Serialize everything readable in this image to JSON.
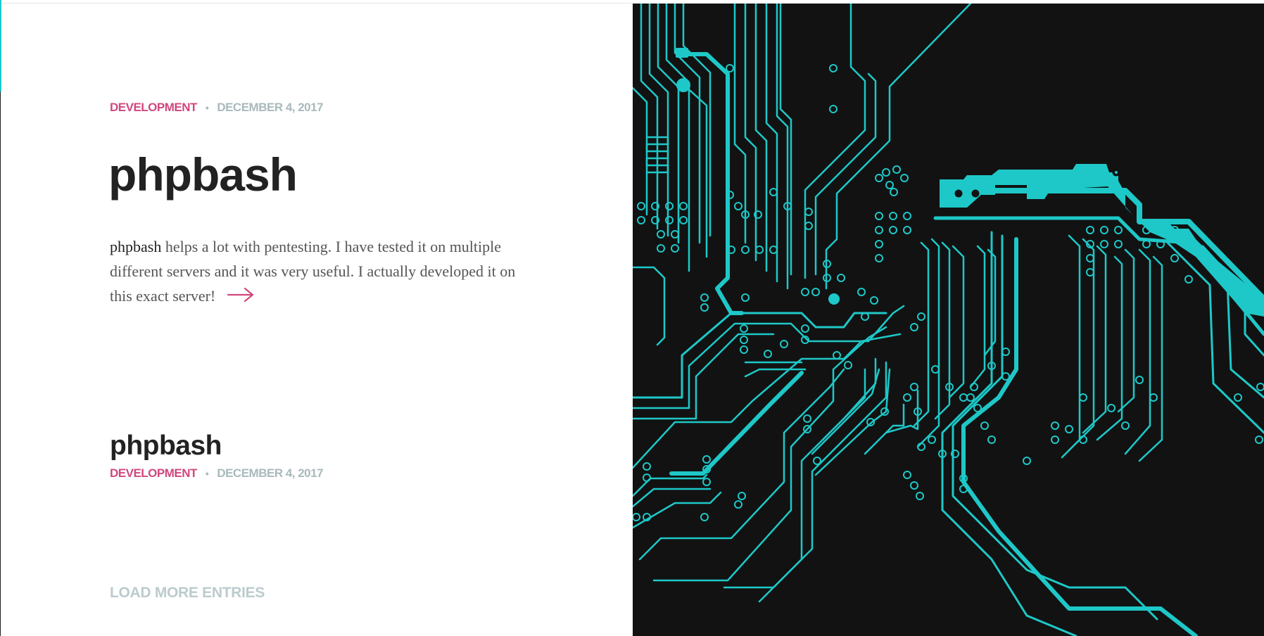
{
  "posts": [
    {
      "category": "DEVELOPMENT",
      "separator": "•",
      "date": "DECEMBER 4, 2017",
      "title": "phpbash",
      "excerpt_lead": "phpbash",
      "excerpt_rest": " helps a lot with pentesting. I have tested it on multiple different servers and it was very useful. I actually developed it on this exact server!",
      "read_more_icon": "arrow-right-icon"
    },
    {
      "title": "phpbash",
      "category": "DEVELOPMENT",
      "separator": "•",
      "date": "DECEMBER 4, 2017"
    }
  ],
  "load_more_label": "LOAD MORE ENTRIES",
  "colors": {
    "accent": "#d0487e",
    "meta_gray": "#a9b9bc",
    "circuit_cyan": "#1ec8c8",
    "art_background": "#121212"
  }
}
